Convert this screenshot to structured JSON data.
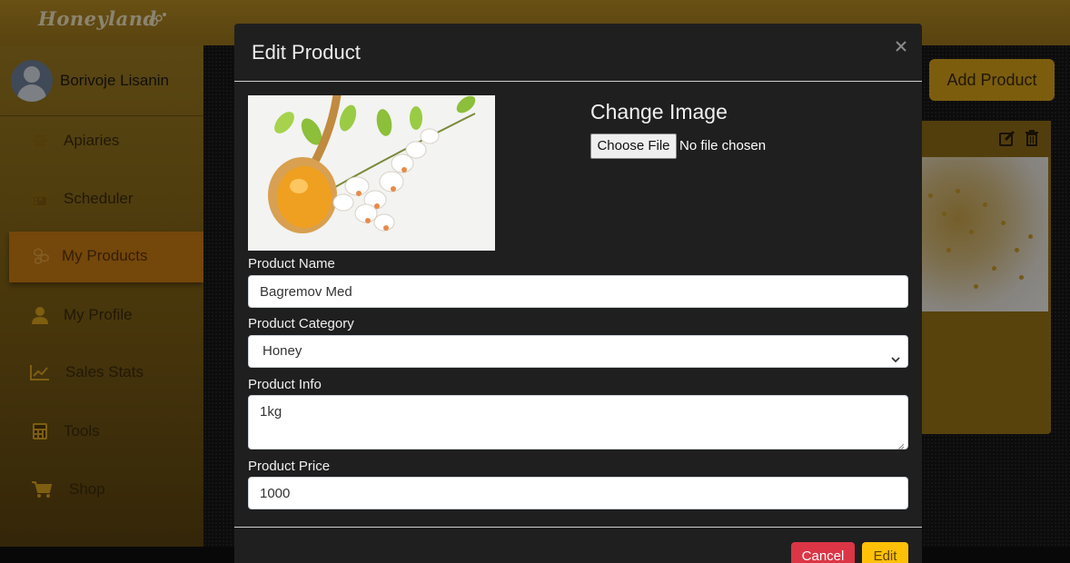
{
  "app": {
    "logo": "Honeyland"
  },
  "user": {
    "name": "Borivoje Lisanin"
  },
  "sidebar": {
    "items": [
      {
        "label": "Apiaries",
        "icon": "hive-icon"
      },
      {
        "label": "Scheduler",
        "icon": "calendar-icon"
      },
      {
        "label": "My Products",
        "icon": "hexagons-icon",
        "active": true
      },
      {
        "label": "My Profile",
        "icon": "user-icon"
      },
      {
        "label": "Sales Stats",
        "icon": "chart-icon"
      },
      {
        "label": "Tools",
        "icon": "calculator-icon"
      },
      {
        "label": "Shop",
        "icon": "cart-icon"
      }
    ]
  },
  "main": {
    "add_product_label": "Add Product"
  },
  "modal": {
    "title": "Edit Product",
    "change_image_label": "Change Image",
    "choose_file_label": "Choose File",
    "no_file_text": "No file chosen",
    "fields": {
      "name": {
        "label": "Product Name",
        "value": "Bagremov Med"
      },
      "category": {
        "label": "Product Category",
        "value": "Honey"
      },
      "info": {
        "label": "Product Info",
        "value": "1kg"
      },
      "price": {
        "label": "Product Price",
        "value": "1000"
      }
    },
    "cancel_label": "Cancel",
    "edit_label": "Edit"
  },
  "colors": {
    "accent": "#d4a018",
    "active_nav": "#c97a12",
    "cancel": "#dc3545",
    "edit": "#ffc107"
  }
}
